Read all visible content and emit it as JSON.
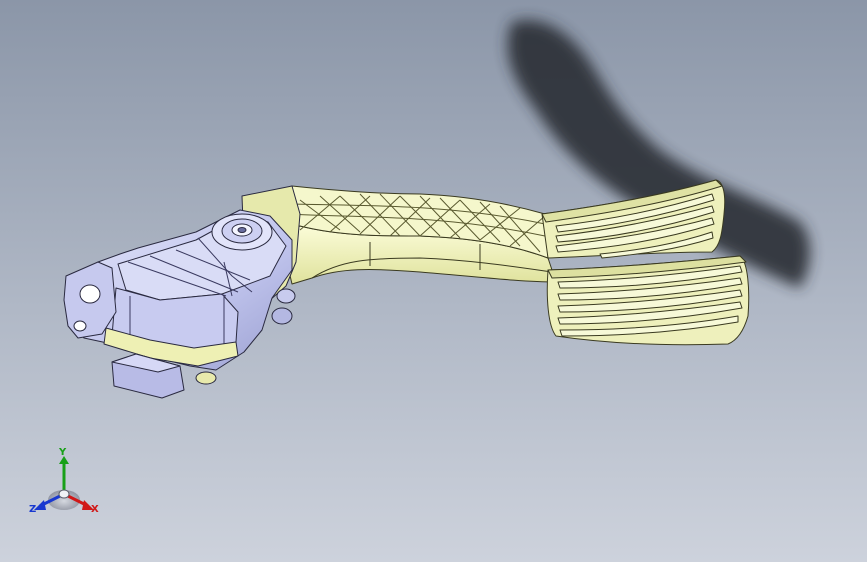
{
  "view": {
    "background_top": "#8b96a8",
    "background_bottom": "#c9ced8",
    "part_color": "#f0f2c0",
    "part_edge": "#3a3a20",
    "housing_color": "#c4c8ee",
    "shadow_color": "#2a2e36"
  },
  "triad": {
    "x_label": "X",
    "y_label": "Y",
    "z_label": "Z",
    "x_color": "#d01818",
    "y_color": "#18a018",
    "z_color": "#1838d0"
  }
}
